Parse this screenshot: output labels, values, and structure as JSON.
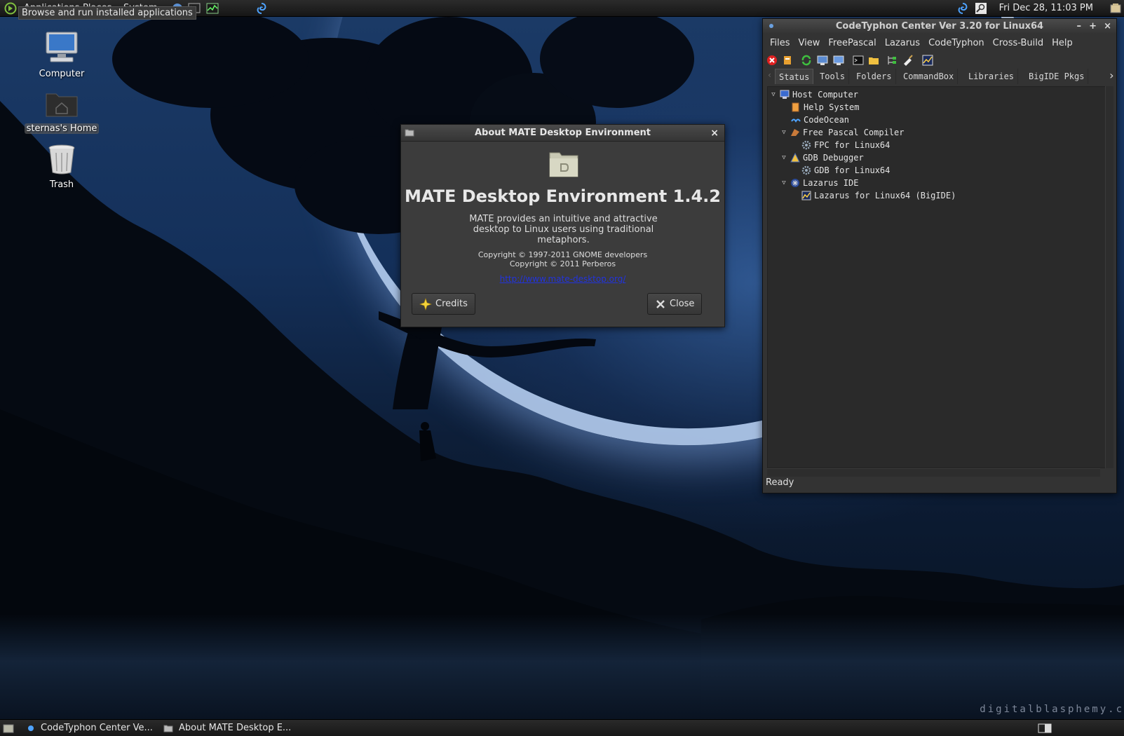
{
  "top_panel": {
    "menus": [
      "Applications",
      "Places",
      "System"
    ],
    "tooltip": "Browse and run installed applications",
    "clock": "Fri Dec 28, 11:03 PM"
  },
  "desktop": {
    "icons": [
      {
        "label": "Computer",
        "icon": "computer-icon"
      },
      {
        "label": "sternas's Home",
        "icon": "home-folder-icon"
      },
      {
        "label": "Trash",
        "icon": "trash-icon"
      }
    ],
    "watermark": "digitalblasphemy.c"
  },
  "about_dialog": {
    "title": "About MATE Desktop Environment",
    "heading": "MATE Desktop Environment 1.4.2",
    "description": "MATE provides an intuitive and attractive desktop to Linux users using traditional metaphors.",
    "copyright_1": "Copyright © 1997-2011 GNOME developers",
    "copyright_2": "Copyright © 2011 Perberos",
    "link": "http://www.mate-desktop.org/",
    "credits_label": "Credits",
    "close_label": "Close",
    "close_glyph": "×"
  },
  "codetyphon": {
    "title": "CodeTyphon Center Ver 3.20 for Linux64",
    "window_controls": [
      "–",
      "+",
      "×"
    ],
    "menu": [
      "Files",
      "View",
      "FreePascal",
      "Lazarus",
      "CodeTyphon",
      "Cross-Build",
      "Help"
    ],
    "tabs": [
      "Status",
      "Tools",
      "Folders",
      "CommandBox",
      "Libraries",
      "BigIDE Pkgs"
    ],
    "active_tab": "Status",
    "tree": [
      {
        "label": "Host Computer",
        "level": 0,
        "expanded": true,
        "icon": "monitor-icon"
      },
      {
        "label": "Help System",
        "level": 1,
        "icon": "help-book-icon"
      },
      {
        "label": "CodeOcean",
        "level": 1,
        "icon": "codeocean-icon"
      },
      {
        "label": "Free Pascal Compiler",
        "level": 1,
        "expanded": true,
        "icon": "fpc-icon"
      },
      {
        "label": "FPC for Linux64",
        "level": 2,
        "icon": "gear-icon"
      },
      {
        "label": "GDB Debugger",
        "level": 1,
        "expanded": true,
        "icon": "gdb-icon"
      },
      {
        "label": "GDB for Linux64",
        "level": 2,
        "icon": "gear-icon"
      },
      {
        "label": "Lazarus IDE",
        "level": 1,
        "expanded": true,
        "icon": "lazarus-icon"
      },
      {
        "label": "Lazarus for Linux64 (BigIDE)",
        "level": 2,
        "icon": "chart-icon"
      }
    ],
    "status": "Ready"
  },
  "taskbar": {
    "tasks": [
      "CodeTyphon Center Ve...",
      "About MATE Desktop E..."
    ]
  },
  "colors": {
    "link": "#2233dd",
    "panel": "#1f1f1f",
    "dialog_bg": "#3c3c3c"
  }
}
